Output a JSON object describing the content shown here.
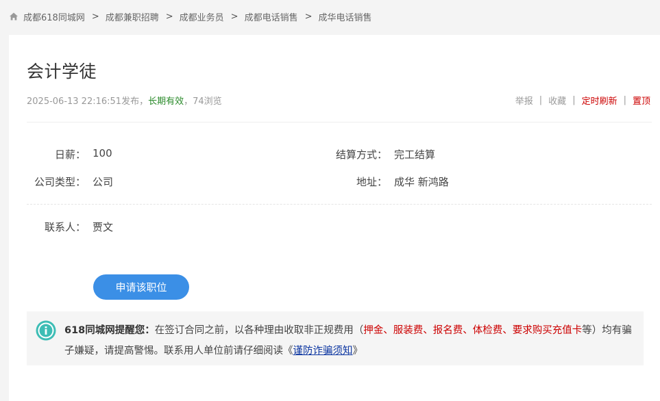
{
  "breadcrumb": {
    "items": [
      "成都618同城网",
      "成都兼职招聘",
      "成都业务员",
      "成都电话销售",
      "成华电话销售"
    ],
    "separator": ">"
  },
  "job": {
    "title": "会计学徒",
    "publish_time": "2025-06-13 22:16:51发布",
    "comma1": "，",
    "validity": "长期有效",
    "comma2": "，",
    "views": "74浏览"
  },
  "actions": {
    "report": "举报",
    "favorite": "收藏",
    "timed_refresh": "定时刷新",
    "pin_top": "置顶",
    "separator": "|"
  },
  "details": {
    "daily_pay_label": "日薪：",
    "daily_pay_value": "100",
    "settlement_label": "结算方式：",
    "settlement_value": "完工结算",
    "company_type_label": "公司类型：",
    "company_type_value": "公司",
    "address_label": "地址：",
    "address_value": "成华 新鸿路",
    "contact_label": "联系人：",
    "contact_value": "贾文"
  },
  "apply_button": "申请该职位",
  "notice": {
    "heading": "618同城网提醒您：",
    "text1": "在签订合同之前，以各种理由收取非正规费用（",
    "fees": "押金、服装费、报名费、体检费、要求购买充值卡",
    "text2": "等）均有骗子嫌疑，请提高警惕。联系用人单位前请仔细阅读《",
    "link": "谨防诈骗须知",
    "text3": "》"
  },
  "colors": {
    "accent_blue": "#3b8fe6",
    "valid_green": "#2a8a2a",
    "alert_red": "#cc0000",
    "info_teal": "#3dbdb5"
  },
  "icons": [
    "home-icon",
    "info-icon"
  ]
}
